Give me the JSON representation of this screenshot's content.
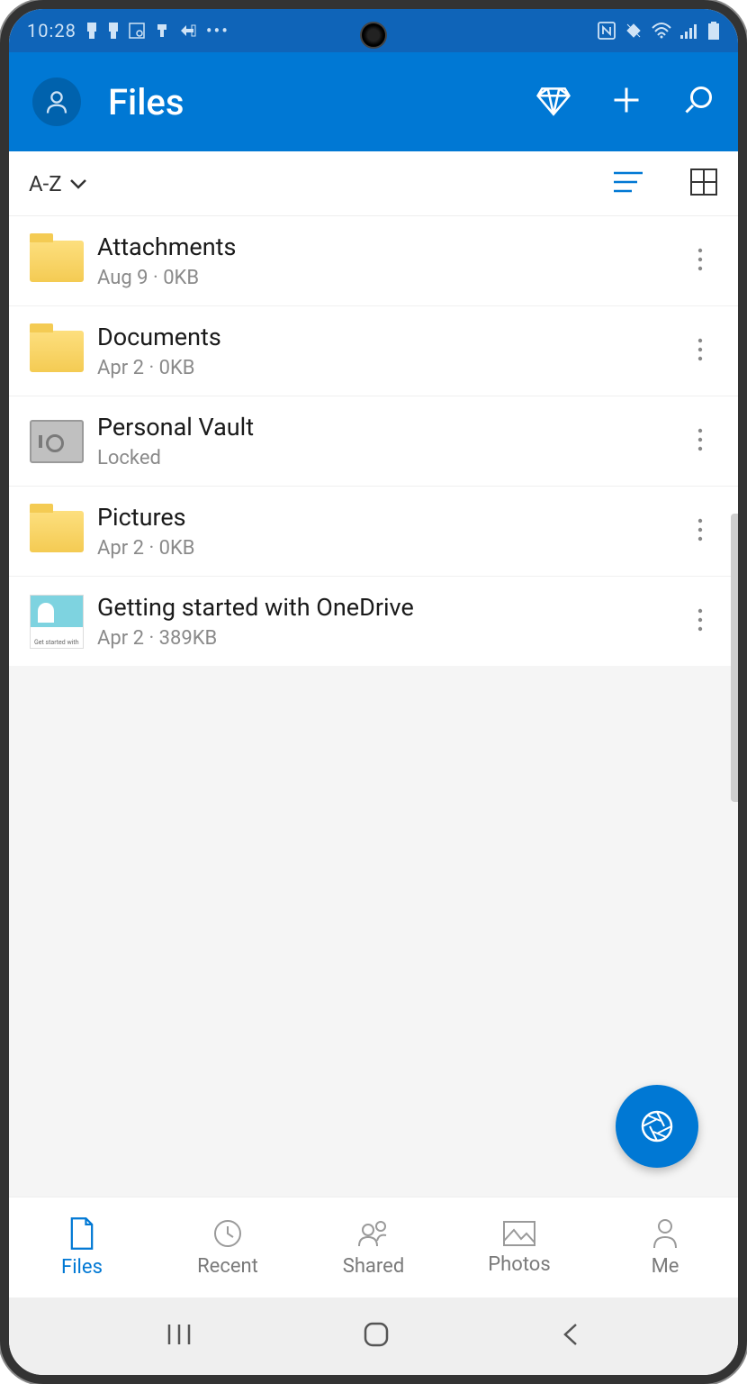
{
  "status_bar": {
    "time": "10:28"
  },
  "header": {
    "title": "Files"
  },
  "toolbar": {
    "sort_label": "A-Z"
  },
  "files": [
    {
      "name": "Attachments",
      "meta": "Aug 9 · 0KB",
      "type": "folder"
    },
    {
      "name": "Documents",
      "meta": "Apr 2 · 0KB",
      "type": "folder"
    },
    {
      "name": "Personal Vault",
      "meta": "Locked",
      "type": "vault"
    },
    {
      "name": "Pictures",
      "meta": "Apr 2 · 0KB",
      "type": "folder"
    },
    {
      "name": "Getting started with OneDrive",
      "meta": "Apr 2 · 389KB",
      "type": "pdf"
    }
  ],
  "bottom_nav": {
    "items": [
      {
        "label": "Files"
      },
      {
        "label": "Recent"
      },
      {
        "label": "Shared"
      },
      {
        "label": "Photos"
      },
      {
        "label": "Me"
      }
    ]
  }
}
